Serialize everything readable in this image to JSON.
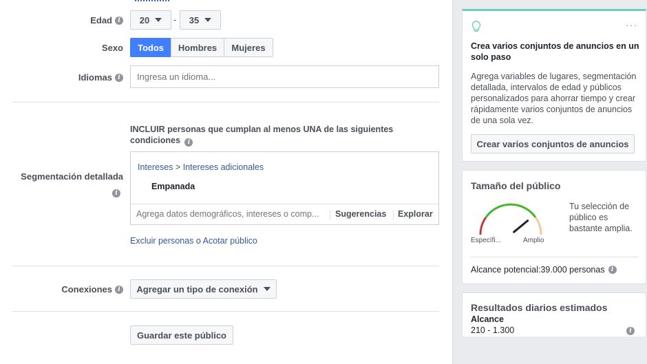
{
  "form": {
    "age": {
      "label": "Edad",
      "min": "20",
      "max": "35",
      "separator": "-"
    },
    "gender": {
      "label": "Sexo",
      "options": [
        "Todos",
        "Hombres",
        "Mujeres"
      ],
      "selected": "Todos"
    },
    "languages": {
      "label": "Idiomas",
      "placeholder": "Ingresa un idioma..."
    },
    "detailed": {
      "label": "Segmentación detallada",
      "include_text": "INCLUIR personas que cumplan al menos UNA de las siguientes condiciones",
      "crumb_a": "Intereses",
      "crumb_sep": ">",
      "crumb_b": "Intereses adicionales",
      "item": "Empanada",
      "search_placeholder": "Agrega datos demográficos, intereses o comp...",
      "suggestions": "Sugerencias",
      "explore": "Explorar",
      "exclude": "Excluir personas",
      "or": "o",
      "narrow": "Acotar público"
    },
    "connections": {
      "label": "Conexiones",
      "button": "Agregar un tipo de conexión"
    },
    "save": "Guardar este público"
  },
  "side": {
    "tip": {
      "title": "Crea varios conjuntos de anuncios en un solo paso",
      "body": "Agrega variables de lugares, segmentación detallada, intervalos de edad y públicos personalizados para ahorrar tiempo y crear rápidamente varios conjuntos de anuncios de una sola vez.",
      "button": "Crear varios conjuntos de anuncios",
      "more": "···",
      "accent": "#6bcebb"
    },
    "audience": {
      "title": "Tamaño del público",
      "left_label": "Específi...",
      "right_label": "Amplio",
      "desc": "Tu selección de público es bastante amplia.",
      "reach": "Alcance potencial:39.000 personas",
      "level": 0.78
    },
    "daily": {
      "title": "Resultados diarios estimados",
      "reach_label": "Alcance",
      "reach_value": "210 - 1.300",
      "bar_color": "#4dc3e9"
    }
  },
  "colors": {
    "primary": "#4080ff",
    "link": "#365899"
  }
}
